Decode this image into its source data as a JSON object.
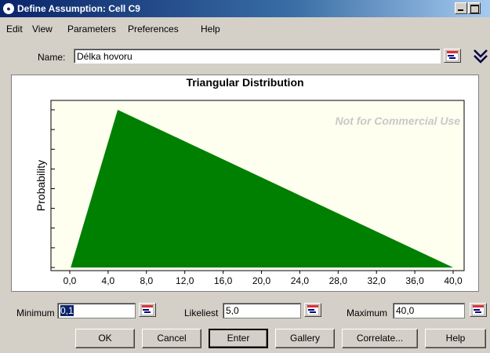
{
  "window": {
    "title": "Define Assumption: Cell C9"
  },
  "menu": [
    "Edit",
    "View",
    "Parameters",
    "Preferences",
    "Help"
  ],
  "name_field": {
    "label": "Name:",
    "value": "Délka hovoru"
  },
  "chart_data": {
    "type": "area",
    "title": "Triangular Distribution",
    "xlabel": "",
    "ylabel": "Probability",
    "watermark": "Not for Commercial Use",
    "x_ticks": [
      "0,0",
      "4,0",
      "8,0",
      "12,0",
      "16,0",
      "20,0",
      "24,0",
      "28,0",
      "32,0",
      "36,0",
      "40,0"
    ],
    "xlim": [
      0,
      40
    ],
    "series": [
      {
        "x": [
          0.1,
          5.0,
          40.0
        ],
        "y": [
          0,
          1,
          0
        ]
      }
    ],
    "fill_color": "#008000",
    "plot_background": "#fffff0",
    "grid": false
  },
  "parameters": {
    "minimum": {
      "label": "Minimum",
      "value": "0,1"
    },
    "likeliest": {
      "label": "Likeliest",
      "value": "5,0"
    },
    "maximum": {
      "label": "Maximum",
      "value": "40,0"
    }
  },
  "buttons": {
    "ok": "OK",
    "cancel": "Cancel",
    "enter": "Enter",
    "gallery": "Gallery",
    "correlate": "Correlate...",
    "help": "Help"
  },
  "icons": {
    "cell_reference": "cell-reference-icon",
    "expand": "chevron-double-down-icon"
  }
}
